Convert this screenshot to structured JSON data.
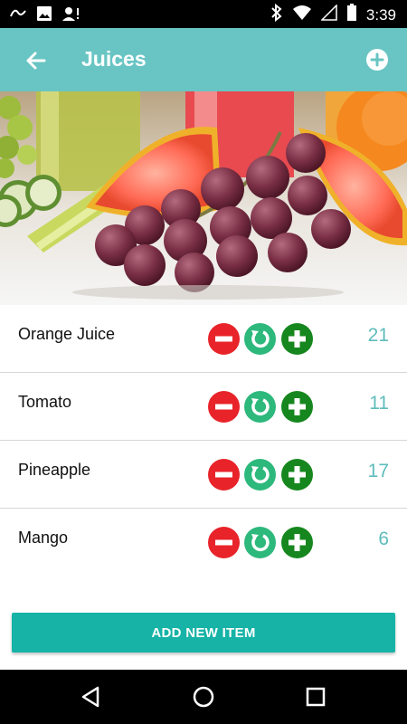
{
  "status_bar": {
    "time": "3:39",
    "left_icons": [
      "notification-icon",
      "image-icon",
      "account-icon"
    ],
    "right_icons": [
      "bluetooth-icon",
      "wifi-icon",
      "signal-icon",
      "battery-icon"
    ]
  },
  "toolbar": {
    "title": "Juices",
    "back_icon": "arrow-back-icon",
    "add_icon": "add-circle-icon",
    "color": "#68c5c3"
  },
  "items": [
    {
      "name": "Orange Juice",
      "count": "21"
    },
    {
      "name": "Tomato",
      "count": "11"
    },
    {
      "name": "Pineapple",
      "count": "17"
    },
    {
      "name": "Mango",
      "count": "6"
    }
  ],
  "row_buttons": {
    "minus_color": "#e8232a",
    "reset_color": "#2db87c",
    "plus_color": "#16871e"
  },
  "add_button_label": "ADD NEW ITEM",
  "nav_bar": {
    "icons": [
      "back-triangle-icon",
      "home-circle-icon",
      "recents-square-icon"
    ]
  }
}
